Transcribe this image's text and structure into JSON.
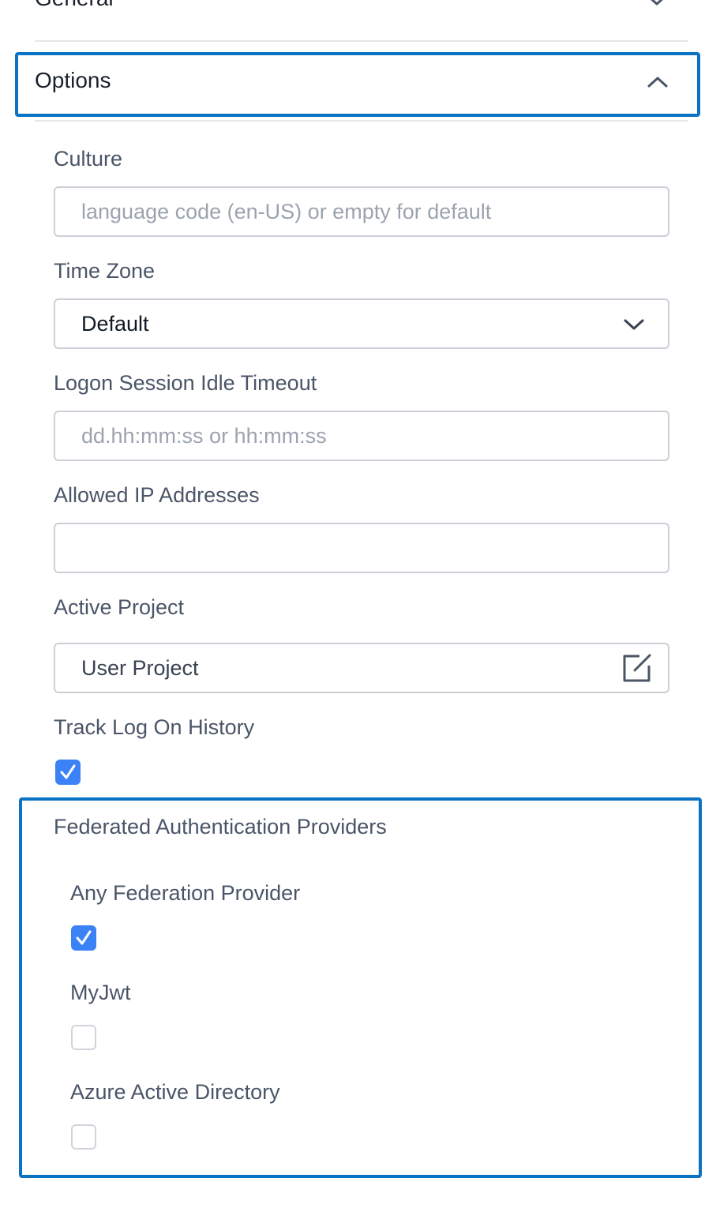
{
  "sections": {
    "general_label": "General",
    "options_label": "Options"
  },
  "fields": {
    "culture": {
      "label": "Culture",
      "placeholder": "language code (en-US) or empty for default",
      "value": ""
    },
    "time_zone": {
      "label": "Time Zone",
      "value": "Default"
    },
    "idle_timeout": {
      "label": "Logon Session Idle Timeout",
      "placeholder": "dd.hh:mm:ss or hh:mm:ss",
      "value": ""
    },
    "allowed_ip": {
      "label": "Allowed IP Addresses",
      "value": ""
    },
    "active_project": {
      "label": "Active Project",
      "value": "User Project"
    },
    "track_log_on": {
      "label": "Track Log On History",
      "checked": true
    }
  },
  "federated": {
    "title": "Federated Authentication Providers",
    "providers": [
      {
        "label": "Any Federation Provider",
        "checked": true
      },
      {
        "label": "MyJwt",
        "checked": false
      },
      {
        "label": "Azure Active Directory",
        "checked": false
      }
    ]
  },
  "colors": {
    "accent_border": "#0a73c4",
    "checkbox_checked": "#3b82f6"
  }
}
